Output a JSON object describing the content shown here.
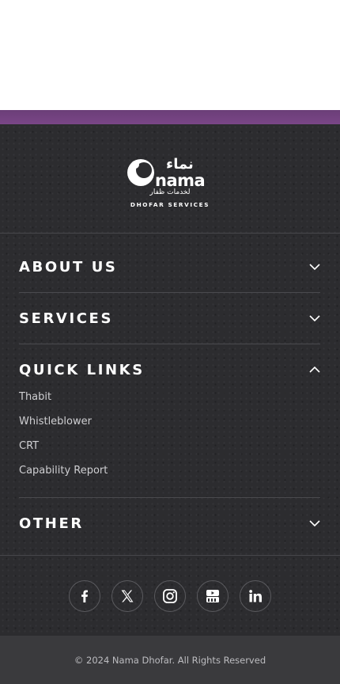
{
  "brand": {
    "logo_latin": "nama",
    "logo_arabic_top": "نماء",
    "logo_arabic_sub": "لخدمات ظفار",
    "logo_tagline": "DHOFAR SERVICES"
  },
  "sections": [
    {
      "title": "ABOUT US",
      "expanded": false
    },
    {
      "title": "SERVICES",
      "expanded": false
    },
    {
      "title": "QUICK LINKS",
      "expanded": true,
      "links": [
        "Thabit",
        "Whistleblower",
        "CRT",
        "Capability Report"
      ]
    },
    {
      "title": "OTHER",
      "expanded": false
    }
  ],
  "social": [
    "facebook-icon",
    "x-twitter-icon",
    "instagram-icon",
    "youtube-icon",
    "linkedin-icon"
  ],
  "copyright": "© 2024 Nama Dhofar. All Rights Reserved",
  "colors": {
    "accent_band": "#7a4687",
    "footer_bg": "#2c2c2f",
    "copyright_bg": "#3a3a3d",
    "text": "#ffffff"
  }
}
